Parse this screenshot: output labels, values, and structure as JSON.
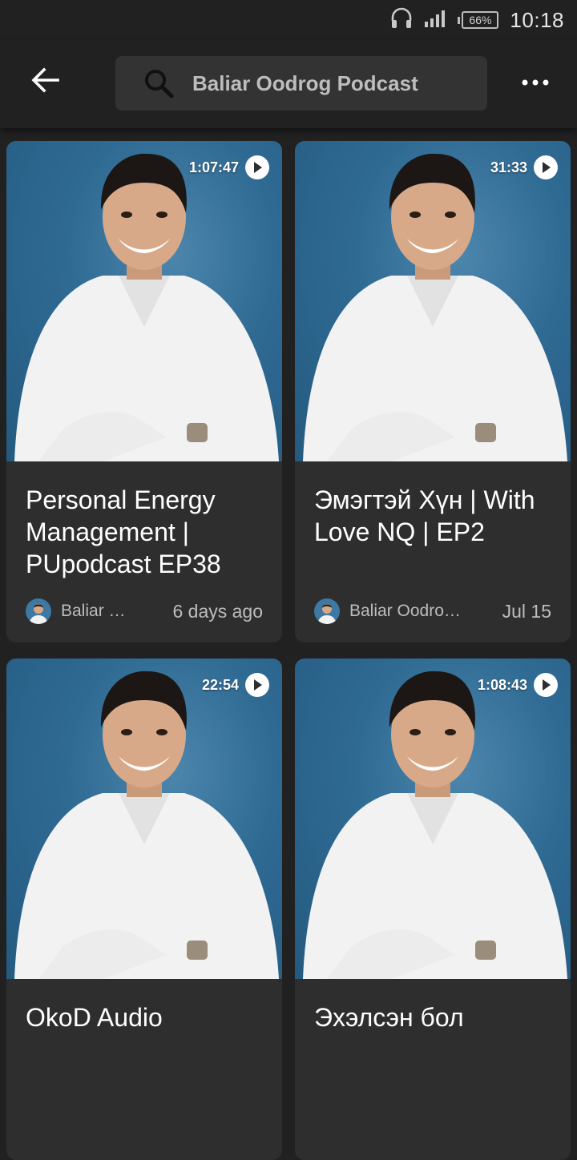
{
  "status_bar": {
    "time": "10:18",
    "battery": "66%",
    "icons": [
      "headset-icon",
      "signal-icon",
      "battery-icon"
    ]
  },
  "app_bar": {
    "back_icon": "arrow-back-icon",
    "search": {
      "value": "Baliar Oodrog Podcast",
      "icon": "search-icon"
    },
    "more_icon": "more-vert-icon"
  },
  "episodes": [
    {
      "duration": "1:07:47",
      "title": "Personal Energy Management | PUpodcast EP38",
      "author": "Baliar …",
      "date": "6 days ago"
    },
    {
      "duration": "31:33",
      "title": "Эмэгтэй Хүн | With Love NQ | EP2",
      "author": "Baliar Oodro…",
      "date": "Jul 15"
    },
    {
      "duration": "22:54",
      "title": "OkoD Audio",
      "author": "",
      "date": ""
    },
    {
      "duration": "1:08:43",
      "title": "Эхэлсэн бол",
      "author": "",
      "date": ""
    }
  ],
  "colors": {
    "background": "#212121",
    "card": "#2e2e2e",
    "search_bg": "#333333",
    "thumb_blue": "#2f6a93"
  }
}
